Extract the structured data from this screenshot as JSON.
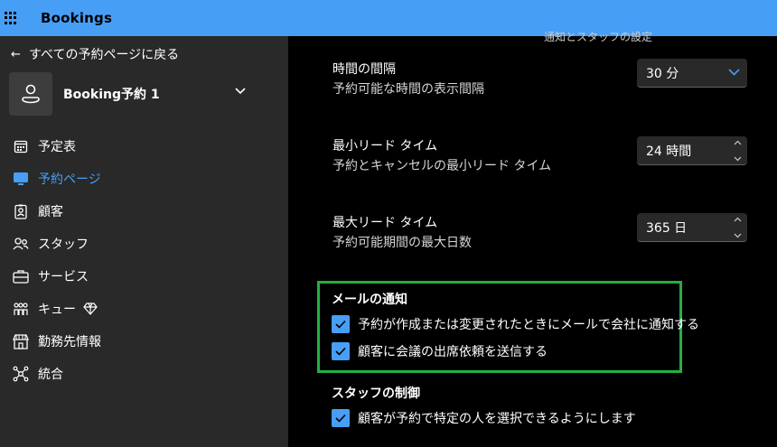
{
  "app": {
    "title": "Bookings"
  },
  "sidebar": {
    "back_label": "すべての予約ページに戻る",
    "booking_name": "Booking予約 1",
    "items": [
      {
        "label": "予定表",
        "icon": "calendar-icon"
      },
      {
        "label": "予約ページ",
        "icon": "monitor-icon",
        "active": true
      },
      {
        "label": "顧客",
        "icon": "contact-card-icon"
      },
      {
        "label": "スタッフ",
        "icon": "people-icon"
      },
      {
        "label": "サービス",
        "icon": "briefcase-icon"
      },
      {
        "label": "キュー",
        "icon": "queue-icon",
        "badge_icon": "diamond-icon"
      },
      {
        "label": "勤務先情報",
        "icon": "building-shop-icon"
      },
      {
        "label": "統合",
        "icon": "integration-icon"
      }
    ]
  },
  "main": {
    "clipped_header": "通知とスタッフの設定",
    "time_interval": {
      "title": "時間の間隔",
      "desc": "予約可能な時間の表示間隔",
      "value": "30 分"
    },
    "min_lead": {
      "title": "最小リード タイム",
      "desc": "予約とキャンセルの最小リード タイム",
      "value": "24 時間"
    },
    "max_lead": {
      "title": "最大リード タイム",
      "desc": "予約可能期間の最大日数",
      "value": "365 日"
    },
    "email_notify": {
      "title": "メールの通知",
      "opt1": "予約が作成または変更されたときにメールで会社に通知する",
      "opt2": "顧客に会議の出席依頼を送信する"
    },
    "staff_control": {
      "title": "スタッフの制御",
      "opt1": "顧客が予約で特定の人を選択できるようにします"
    }
  },
  "colors": {
    "accent": "#479ef5",
    "highlight_border": "#22b043",
    "sidebar_bg": "#292929",
    "main_bg": "#000000"
  }
}
